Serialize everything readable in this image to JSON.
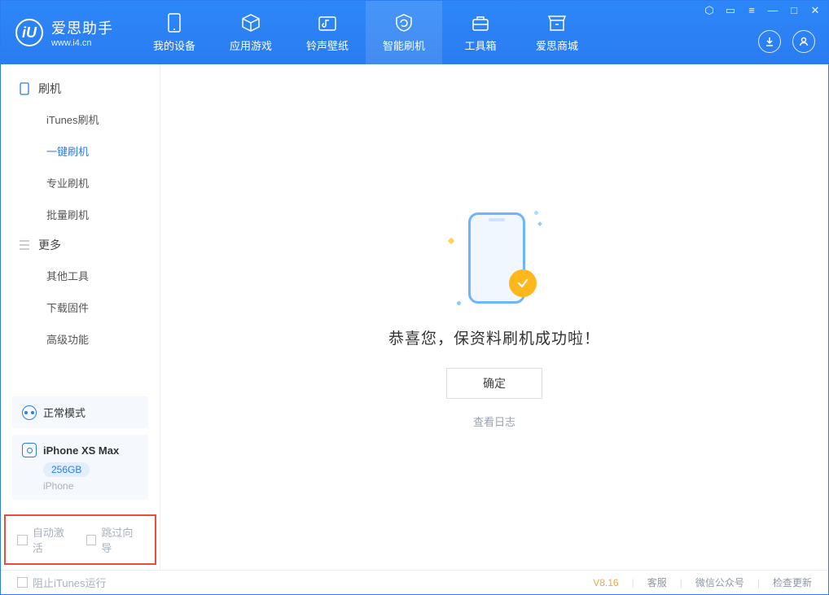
{
  "app": {
    "name": "爱思助手",
    "url": "www.i4.cn",
    "logo_letter": "iU"
  },
  "nav": {
    "tabs": [
      {
        "label": "我的设备"
      },
      {
        "label": "应用游戏"
      },
      {
        "label": "铃声壁纸"
      },
      {
        "label": "智能刷机"
      },
      {
        "label": "工具箱"
      },
      {
        "label": "爱思商城"
      }
    ]
  },
  "sidebar": {
    "group_flash": {
      "title": "刷机"
    },
    "flash_items": [
      {
        "label": "iTunes刷机"
      },
      {
        "label": "一键刷机"
      },
      {
        "label": "专业刷机"
      },
      {
        "label": "批量刷机"
      }
    ],
    "group_more": {
      "title": "更多"
    },
    "more_items": [
      {
        "label": "其他工具"
      },
      {
        "label": "下载固件"
      },
      {
        "label": "高级功能"
      }
    ],
    "mode": {
      "label": "正常模式"
    },
    "device": {
      "name": "iPhone XS Max",
      "capacity": "256GB",
      "type": "iPhone"
    },
    "checks": {
      "auto_activate": "自动激活",
      "skip_guide": "跳过向导"
    }
  },
  "main": {
    "success_text": "恭喜您，保资料刷机成功啦！",
    "ok_label": "确定",
    "view_log": "查看日志"
  },
  "footer": {
    "block_itunes": "阻止iTunes运行",
    "version": "V8.16",
    "support": "客服",
    "wechat": "微信公众号",
    "check_update": "检查更新"
  }
}
